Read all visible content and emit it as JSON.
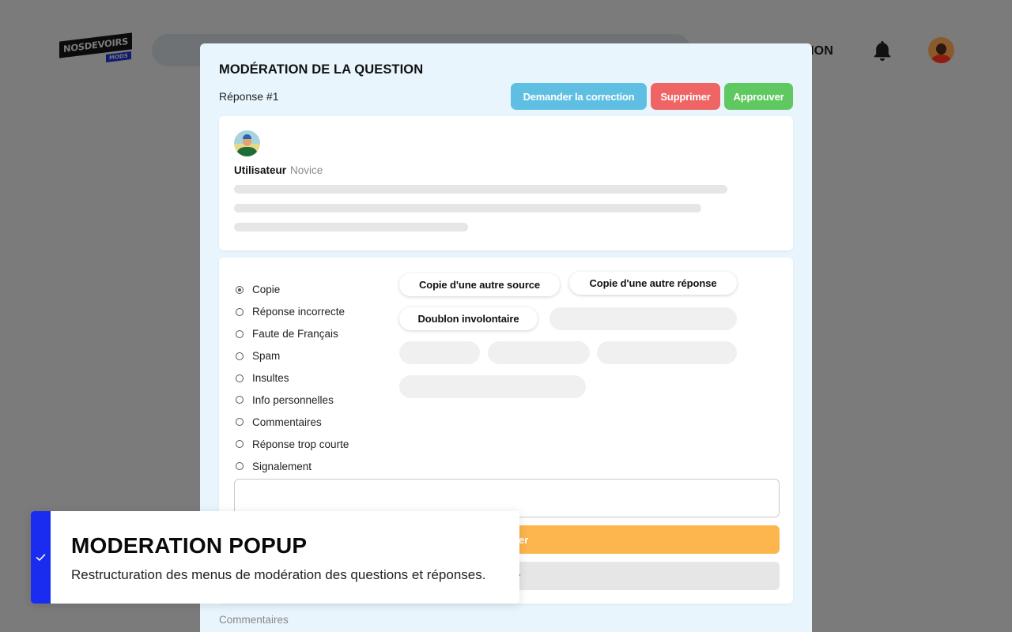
{
  "header": {
    "logo_main": "NOSDEVOIRS",
    "logo_sub": "MODS",
    "nav_partial": "TION",
    "icons": {
      "notifications": "bell-icon",
      "avatar": "user-avatar"
    }
  },
  "modal": {
    "title": "MODÉRATION DE LA QUESTION",
    "answer_label": "Réponse #1",
    "buttons": {
      "request_correction": "Demander la correction",
      "delete": "Supprimer",
      "approve": "Approuver"
    },
    "colors": {
      "request_correction": "#5ebfe3",
      "delete": "#ef6566",
      "approve": "#60c860",
      "orange_action": "#fcb64d"
    },
    "author": {
      "name": "Utilisateur",
      "rank": "Novice"
    },
    "reasons": [
      {
        "label": "Copie",
        "selected": true
      },
      {
        "label": "Réponse incorrecte",
        "selected": false
      },
      {
        "label": "Faute de Français",
        "selected": false
      },
      {
        "label": "Spam",
        "selected": false
      },
      {
        "label": "Insultes",
        "selected": false
      },
      {
        "label": "Info personnelles",
        "selected": false
      },
      {
        "label": "Commentaires",
        "selected": false
      },
      {
        "label": "Réponse trop courte",
        "selected": false
      },
      {
        "label": "Signalement",
        "selected": false
      }
    ],
    "sub_reasons": [
      "Copie d'une autre source",
      "Copie d'une autre réponse",
      "Doublon involontaire"
    ],
    "comment_value": "",
    "orange_button_partial": "ner",
    "grey_button_partial": "r",
    "comments_label": "Commentaires"
  },
  "toast": {
    "title": "MODERATION POPUP",
    "message": "Restructuration des menus de modération des questions et réponses.",
    "accent_color": "#1a2cf0",
    "icon": "check-icon"
  }
}
